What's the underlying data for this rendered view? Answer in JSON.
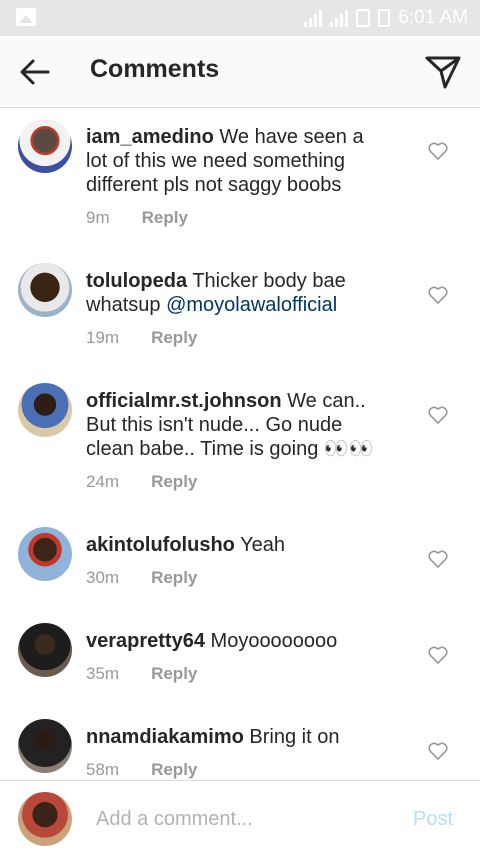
{
  "status_bar": {
    "time": "6:01 AM"
  },
  "header": {
    "title": "Comments"
  },
  "reply_label": "Reply",
  "comments": [
    {
      "username": "iam_amedino",
      "text": "We have seen a lot of this we need something different pls not saggy boobs",
      "mention": "",
      "time": "9m"
    },
    {
      "username": "tolulopeda",
      "text": "Thicker body bae whatsup",
      "mention": "@moyolawalofficial",
      "time": "19m"
    },
    {
      "username": "officialmr.st.johnson",
      "text": "We can.. But this isn't nude... Go nude clean babe.. Time is going 👀👀",
      "mention": "",
      "time": "24m"
    },
    {
      "username": "akintolufolusho",
      "text": "Yeah",
      "mention": "",
      "time": "30m"
    },
    {
      "username": "verapretty64",
      "text": "Moyoooooooo",
      "mention": "",
      "time": "35m"
    },
    {
      "username": "nnamdiakamimo",
      "text": "Bring it on",
      "mention": "",
      "time": "58m"
    }
  ],
  "composer": {
    "placeholder": "Add a comment...",
    "post_label": "Post"
  },
  "colors": {
    "link": "#003569",
    "post_disabled": "#b2dffc",
    "meta": "#999999"
  }
}
